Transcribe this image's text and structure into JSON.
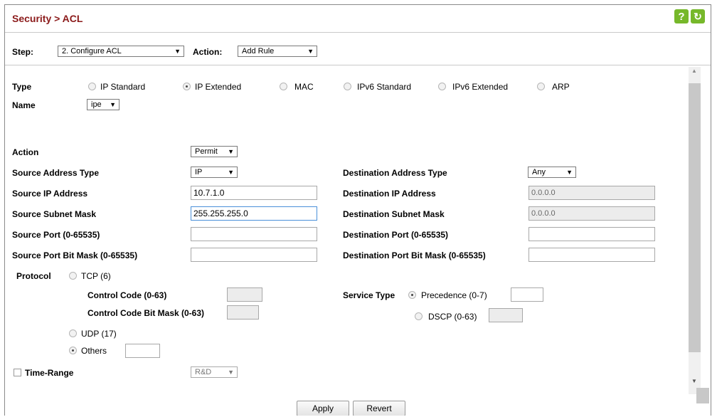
{
  "header": {
    "title": "Security > ACL",
    "help_icon": "?",
    "refresh_icon": "↻"
  },
  "stepbar": {
    "step_label": "Step:",
    "step_value": "2. Configure ACL",
    "action_label": "Action:",
    "action_value": "Add Rule"
  },
  "type": {
    "label": "Type",
    "options": [
      "IP Standard",
      "IP Extended",
      "MAC",
      "IPv6 Standard",
      "IPv6 Extended",
      "ARP"
    ],
    "selected": "IP Extended"
  },
  "name": {
    "label": "Name",
    "value": "ipe"
  },
  "action": {
    "label": "Action",
    "value": "Permit"
  },
  "source": {
    "address_type_label": "Source Address Type",
    "address_type_value": "IP",
    "ip_label": "Source IP Address",
    "ip_value": "10.7.1.0",
    "mask_label": "Source Subnet Mask",
    "mask_value": "255.255.255.0",
    "port_label": "Source Port (0-65535)",
    "port_value": "",
    "port_mask_label": "Source Port Bit Mask (0-65535)",
    "port_mask_value": ""
  },
  "destination": {
    "address_type_label": "Destination Address Type",
    "address_type_value": "Any",
    "ip_label": "Destination IP Address",
    "ip_value": "0.0.0.0",
    "mask_label": "Destination Subnet Mask",
    "mask_value": "0.0.0.0",
    "port_label": "Destination Port (0-65535)",
    "port_value": "",
    "port_mask_label": "Destination Port Bit Mask (0-65535)",
    "port_mask_value": ""
  },
  "protocol": {
    "label": "Protocol",
    "tcp_label": "TCP (6)",
    "control_code_label": "Control Code (0-63)",
    "control_code_mask_label": "Control Code Bit Mask (0-63)",
    "udp_label": "UDP (17)",
    "others_label": "Others",
    "others_value": "",
    "selected": "Others"
  },
  "service": {
    "label": "Service Type",
    "precedence_label": "Precedence (0-7)",
    "dscp_label": "DSCP (0-63)",
    "selected": "Precedence (0-7)"
  },
  "time_range": {
    "label": "Time-Range",
    "value": "R&D"
  },
  "buttons": {
    "apply": "Apply",
    "revert": "Revert"
  },
  "colors": {
    "title": "#8b1a1a",
    "header_button": "#76b82a"
  }
}
